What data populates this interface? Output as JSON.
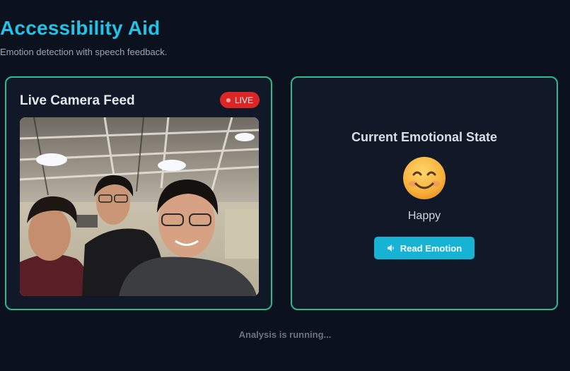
{
  "header": {
    "title": "Accessibility Aid",
    "subtitle": "Emotion detection with speech feedback."
  },
  "camera_panel": {
    "title": "Live Camera Feed",
    "live_badge": "LIVE"
  },
  "emotion_panel": {
    "title": "Current Emotional State",
    "emoji_icon": "smiling-face-icon",
    "emotion": "Happy",
    "read_button_label": "Read Emotion",
    "read_button_icon": "speaker-icon"
  },
  "status": "Analysis is running...",
  "colors": {
    "accent": "#22c3e6",
    "panel_border": "#2fb98f",
    "live": "#dc2626",
    "button": "#16b3d4"
  }
}
